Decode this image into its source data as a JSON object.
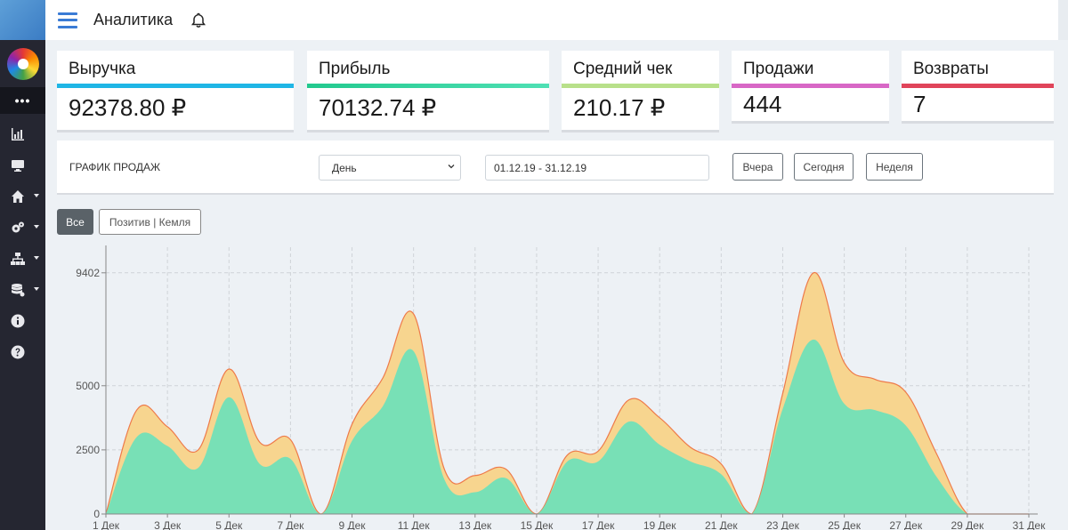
{
  "header": {
    "title": "Аналитика"
  },
  "sidebar": {
    "items": [
      {
        "icon": "chart-bar-icon"
      },
      {
        "icon": "monitor-icon"
      },
      {
        "icon": "home-icon",
        "caret": true
      },
      {
        "icon": "cogs-icon",
        "caret": true
      },
      {
        "icon": "sitemap-icon",
        "caret": true
      },
      {
        "icon": "database-icon",
        "caret": true
      },
      {
        "icon": "info-icon"
      },
      {
        "icon": "help-icon"
      }
    ]
  },
  "cards": [
    {
      "label": "Выручка",
      "value": "92378.80 ₽",
      "color": "#1fb6e6"
    },
    {
      "label": "Прибыль",
      "value": "70132.74 ₽",
      "color": "#2ed39a"
    },
    {
      "label": "Средний чек",
      "value": "210.17 ₽",
      "color": "#b8e08a"
    },
    {
      "label": "Продажи",
      "value": "444",
      "color": "#d867c6"
    },
    {
      "label": "Возвраты",
      "value": "7",
      "color": "#e0445a"
    }
  ],
  "controls": {
    "title": "ГРАФИК ПРОДАЖ",
    "period_select": "День",
    "date_range": "01.12.19 - 31.12.19",
    "buttons": {
      "yesterday": "Вчера",
      "today": "Сегодня",
      "week": "Неделя"
    }
  },
  "filters": {
    "all": "Все",
    "store": "Позитив | Кемля"
  },
  "chart_data": {
    "type": "area",
    "x": [
      "1 Дек",
      "2 Дек",
      "3 Дек",
      "4 Дек",
      "5 Дек",
      "6 Дек",
      "7 Дек",
      "8 Дек",
      "9 Дек",
      "10 Дек",
      "11 Дек",
      "12 Дек",
      "13 Дек",
      "14 Дек",
      "15 Дек",
      "16 Дек",
      "17 Дек",
      "18 Дек",
      "19 Дек",
      "20 Дек",
      "21 Дек",
      "22 Дек",
      "23 Дек",
      "24 Дек",
      "25 Дек",
      "26 Дек",
      "27 Дек",
      "28 Дек",
      "29 Дек",
      "30 Дек",
      "31 Дек"
    ],
    "xticks": [
      "1 Дек",
      "3 Дек",
      "5 Дек",
      "7 Дек",
      "9 Дек",
      "11 Дек",
      "13 Дек",
      "15 Дек",
      "17 Дек",
      "19 Дек",
      "21 Дек",
      "23 Дек",
      "25 Дек",
      "27 Дек",
      "29 Дек",
      "31 Дек"
    ],
    "yticks": [
      0,
      2500,
      5000,
      9402
    ],
    "ylim": [
      0,
      10400
    ],
    "grid": true,
    "series": [
      {
        "values": [
          0,
          4050,
          3400,
          2500,
          5650,
          2800,
          2900,
          0,
          3500,
          5300,
          7800,
          1750,
          1500,
          1750,
          0,
          2300,
          2450,
          4450,
          3750,
          2600,
          1950,
          0,
          4700,
          9402,
          5900,
          5250,
          4750,
          2350,
          0,
          0,
          0
        ],
        "color": "#f7d58f",
        "line": "#ee7a4a"
      },
      {
        "values": [
          0,
          3000,
          2650,
          1800,
          4550,
          1950,
          2150,
          0,
          2850,
          4200,
          6350,
          1350,
          850,
          1400,
          0,
          2050,
          2050,
          3600,
          2700,
          2050,
          1550,
          0,
          4100,
          6800,
          4300,
          4050,
          3450,
          1450,
          0,
          0,
          0
        ],
        "color": "#78e0b6"
      }
    ]
  }
}
